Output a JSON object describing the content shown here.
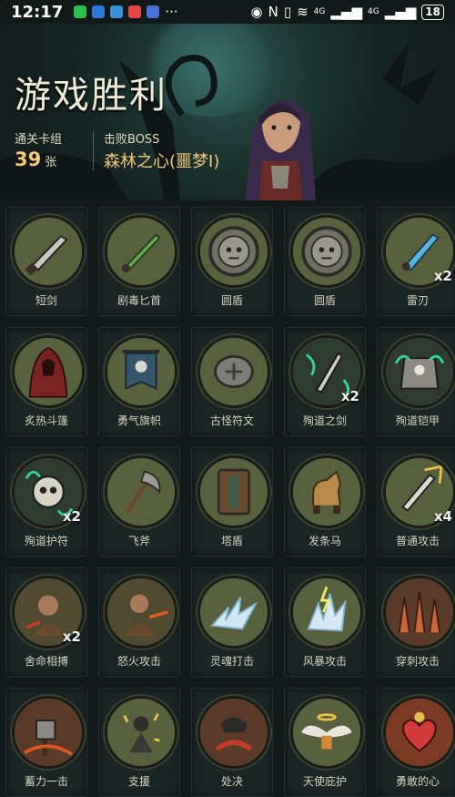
{
  "status": {
    "time": "12:17",
    "network": "4G",
    "battery": "18"
  },
  "header": {
    "title": "游戏胜利",
    "cleared_label": "通关卡组",
    "cleared_value": "39",
    "cleared_unit": "张",
    "boss_label": "击败BOSS",
    "boss_name": "森林之心(噩梦I)"
  },
  "cards": [
    {
      "name": "短剑",
      "count": "",
      "icon": "dagger-icon"
    },
    {
      "name": "剧毒匕首",
      "count": "",
      "icon": "poison-dagger-icon"
    },
    {
      "name": "圆盾",
      "count": "",
      "icon": "round-shield-icon"
    },
    {
      "name": "圆盾",
      "count": "",
      "icon": "round-shield-icon"
    },
    {
      "name": "雷刃",
      "count": "x2",
      "icon": "thunder-blade-icon"
    },
    {
      "name": "炙热斗篷",
      "count": "",
      "icon": "cloak-icon"
    },
    {
      "name": "勇气旗帜",
      "count": "",
      "icon": "banner-icon"
    },
    {
      "name": "古怪符文",
      "count": "",
      "icon": "rune-icon"
    },
    {
      "name": "殉道之剑",
      "count": "x2",
      "icon": "martyr-sword-icon"
    },
    {
      "name": "殉道铠甲",
      "count": "",
      "icon": "martyr-armor-icon"
    },
    {
      "name": "殉道护符",
      "count": "x2",
      "icon": "martyr-amulet-icon"
    },
    {
      "name": "飞斧",
      "count": "",
      "icon": "axe-icon"
    },
    {
      "name": "塔盾",
      "count": "",
      "icon": "tower-shield-icon"
    },
    {
      "name": "发条马",
      "count": "",
      "icon": "clockwork-horse-icon"
    },
    {
      "name": "普通攻击",
      "count": "x4",
      "icon": "basic-attack-icon"
    },
    {
      "name": "舍命相搏",
      "count": "x2",
      "icon": "desperate-fight-icon"
    },
    {
      "name": "怒火攻击",
      "count": "",
      "icon": "rage-attack-icon"
    },
    {
      "name": "灵魂打击",
      "count": "",
      "icon": "soul-strike-icon"
    },
    {
      "name": "风暴攻击",
      "count": "",
      "icon": "storm-attack-icon"
    },
    {
      "name": "穿刺攻击",
      "count": "",
      "icon": "pierce-attack-icon"
    },
    {
      "name": "蓄力一击",
      "count": "",
      "icon": "charged-strike-icon"
    },
    {
      "name": "支援",
      "count": "",
      "icon": "support-icon"
    },
    {
      "name": "处决",
      "count": "",
      "icon": "execute-icon"
    },
    {
      "name": "天使庇护",
      "count": "",
      "icon": "angel-shield-icon"
    },
    {
      "name": "勇敢的心",
      "count": "",
      "icon": "brave-heart-icon"
    }
  ]
}
